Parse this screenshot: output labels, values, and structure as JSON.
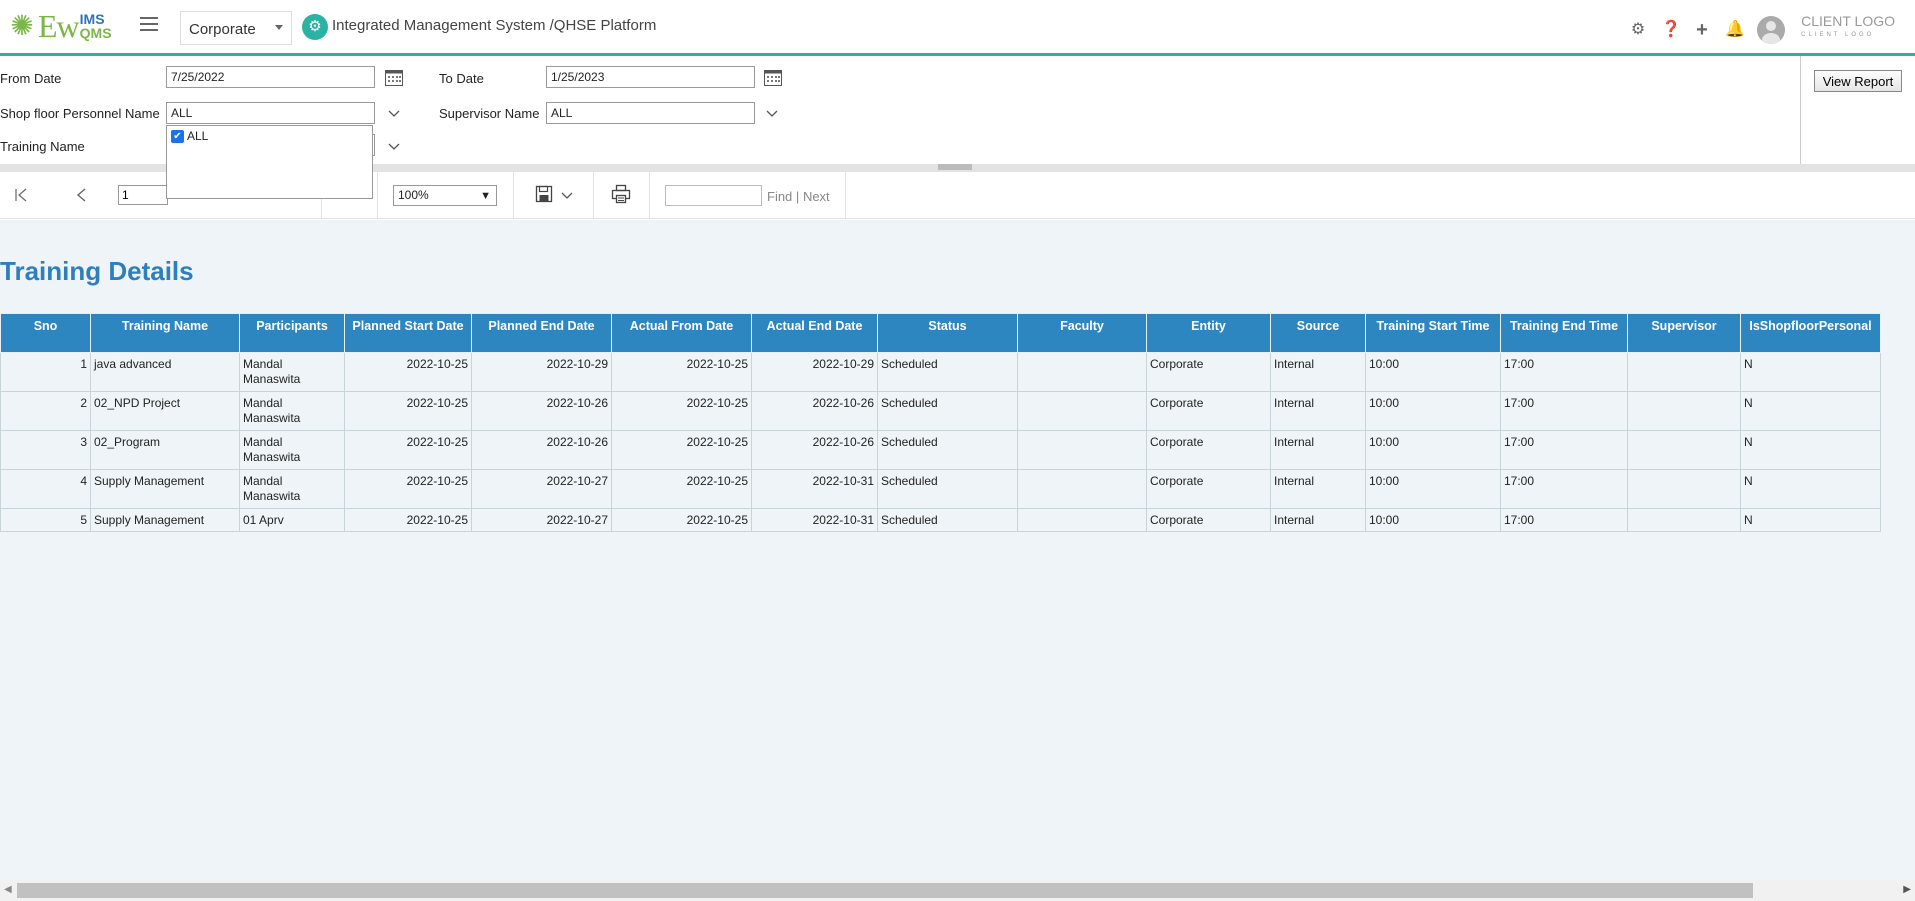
{
  "header": {
    "logo_ew": "Ew",
    "logo_ims": "IMS",
    "logo_qms": "QMS",
    "entity_select": "Corporate",
    "app_title": "Integrated Management System /QHSE Platform",
    "client_logo": "CLIENT LOGO",
    "client_logo_sub": "CLIENT LOGO",
    "accent_color": "#2ab3a3"
  },
  "params": {
    "from_date_label": "From Date",
    "from_date_value": "7/25/2022",
    "to_date_label": "To Date",
    "to_date_value": "1/25/2023",
    "shopfloor_label": "Shop floor Personnel Name",
    "shopfloor_value": "ALL",
    "supervisor_label": "Supervisor Name",
    "supervisor_value": "ALL",
    "training_label": "Training Name",
    "dropdown_option": "ALL",
    "view_report": "View Report"
  },
  "toolbar": {
    "page": "1",
    "zoom": "100%",
    "find": "Find",
    "sep": "|",
    "next": "Next"
  },
  "report": {
    "title": "Training Details",
    "header_color": "#2e86c1",
    "columns": [
      "Sno",
      "Training Name",
      "Participants",
      "Planned Start Date",
      "Planned End Date",
      "Actual From Date",
      "Actual End Date",
      "Status",
      "Faculty",
      "Entity",
      "Source",
      "Training Start Time",
      "Training End Time",
      "Supervisor",
      "IsShopfloorPersonal"
    ],
    "rows": [
      [
        "1",
        "java advanced",
        "Mandal Manaswita",
        "2022-10-25",
        "2022-10-29",
        "2022-10-25",
        "2022-10-29",
        "Scheduled",
        "",
        "Corporate",
        "Internal",
        "10:00",
        "17:00",
        "",
        "N"
      ],
      [
        "2",
        "02_NPD Project",
        "Mandal Manaswita",
        "2022-10-25",
        "2022-10-26",
        "2022-10-25",
        "2022-10-26",
        "Scheduled",
        "",
        "Corporate",
        "Internal",
        "10:00",
        "17:00",
        "",
        "N"
      ],
      [
        "3",
        "02_Program",
        "Mandal Manaswita",
        "2022-10-25",
        "2022-10-26",
        "2022-10-25",
        "2022-10-26",
        "Scheduled",
        "",
        "Corporate",
        "Internal",
        "10:00",
        "17:00",
        "",
        "N"
      ],
      [
        "4",
        "Supply Management",
        "Mandal Manaswita",
        "2022-10-25",
        "2022-10-27",
        "2022-10-25",
        "2022-10-31",
        "Scheduled",
        "",
        "Corporate",
        "Internal",
        "10:00",
        "17:00",
        "",
        "N"
      ],
      [
        "5",
        "Supply Management",
        "01 Aprv",
        "2022-10-25",
        "2022-10-27",
        "2022-10-25",
        "2022-10-31",
        "Scheduled",
        "",
        "Corporate",
        "Internal",
        "10:00",
        "17:00",
        "",
        "N"
      ]
    ]
  }
}
